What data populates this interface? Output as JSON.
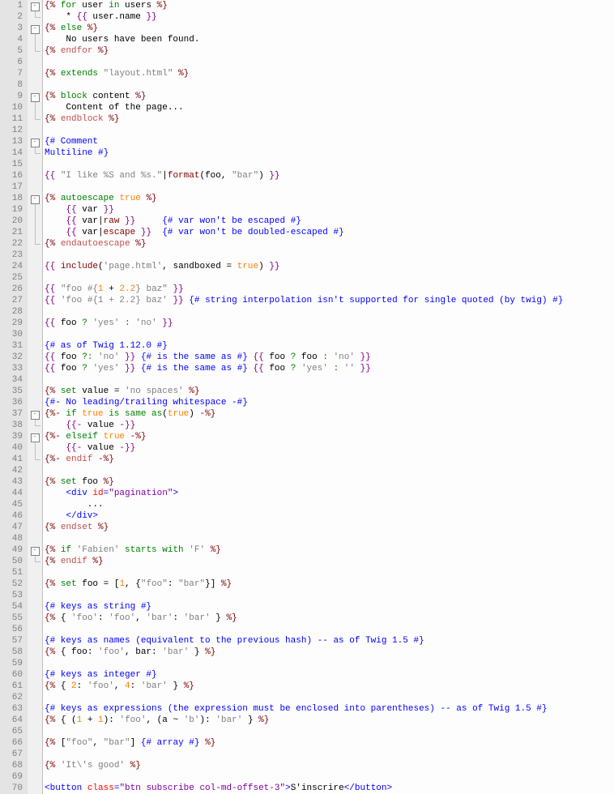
{
  "line_count": 70,
  "fold_markers": {
    "1": "open",
    "2": "line-end",
    "3": "open",
    "4": "line",
    "5": "end",
    "9": "open",
    "10": "line",
    "11": "end",
    "13": "open",
    "14": "end",
    "18": "open",
    "19": "line",
    "20": "line",
    "21": "line",
    "22": "end",
    "37": "open",
    "38": "end",
    "39": "open",
    "40": "line",
    "41": "end",
    "49": "open",
    "50": "end"
  },
  "lines": [
    {
      "n": 1,
      "segs": [
        [
          "tag",
          "{% "
        ],
        [
          "kw",
          "for"
        ],
        [
          "name",
          " user "
        ],
        [
          "kw",
          "in"
        ],
        [
          "name",
          " users "
        ],
        [
          "tag",
          "%}"
        ]
      ]
    },
    {
      "n": 2,
      "segs": [
        [
          "name",
          "    * "
        ],
        [
          "brace",
          "{{ "
        ],
        [
          "name",
          "user.name"
        ],
        [
          "brace",
          " }}"
        ]
      ]
    },
    {
      "n": 3,
      "segs": [
        [
          "tag",
          "{% "
        ],
        [
          "kw",
          "else"
        ],
        [
          "tag",
          " %}"
        ]
      ]
    },
    {
      "n": 4,
      "segs": [
        [
          "name",
          "    No users have been found."
        ]
      ]
    },
    {
      "n": 5,
      "segs": [
        [
          "tag",
          "{% "
        ],
        [
          "tgt",
          "endfor"
        ],
        [
          "tag",
          " %}"
        ]
      ]
    },
    {
      "n": 6,
      "segs": []
    },
    {
      "n": 7,
      "segs": [
        [
          "tag",
          "{% "
        ],
        [
          "kw",
          "extends"
        ],
        [
          "name",
          " "
        ],
        [
          "str",
          "\"layout.html\""
        ],
        [
          "tag",
          " %}"
        ]
      ]
    },
    {
      "n": 8,
      "segs": []
    },
    {
      "n": 9,
      "segs": [
        [
          "tag",
          "{% "
        ],
        [
          "kw",
          "block"
        ],
        [
          "name",
          " content "
        ],
        [
          "tag",
          "%}"
        ]
      ]
    },
    {
      "n": 10,
      "segs": [
        [
          "name",
          "    Content of the page..."
        ]
      ]
    },
    {
      "n": 11,
      "segs": [
        [
          "tag",
          "{% "
        ],
        [
          "tgt",
          "endblock"
        ],
        [
          "tag",
          " %}"
        ]
      ]
    },
    {
      "n": 12,
      "segs": []
    },
    {
      "n": 13,
      "segs": [
        [
          "cmt",
          "{# Comment"
        ]
      ]
    },
    {
      "n": 14,
      "segs": [
        [
          "cmt",
          "Multiline #}"
        ]
      ]
    },
    {
      "n": 15,
      "segs": []
    },
    {
      "n": 16,
      "segs": [
        [
          "brace",
          "{{ "
        ],
        [
          "str",
          "\"I like %S and %s.\""
        ],
        [
          "name",
          "|"
        ],
        [
          "func",
          "format"
        ],
        [
          "name",
          "("
        ],
        [
          "name",
          "foo"
        ],
        [
          "name",
          ", "
        ],
        [
          "str",
          "\"bar\""
        ],
        [
          "name",
          ") "
        ],
        [
          "brace",
          "}}"
        ]
      ]
    },
    {
      "n": 17,
      "segs": []
    },
    {
      "n": 18,
      "segs": [
        [
          "tag",
          "{% "
        ],
        [
          "kw",
          "autoescape"
        ],
        [
          "name",
          " "
        ],
        [
          "orange",
          "true"
        ],
        [
          "tag",
          " %}"
        ]
      ]
    },
    {
      "n": 19,
      "segs": [
        [
          "name",
          "    "
        ],
        [
          "brace",
          "{{ "
        ],
        [
          "name",
          "var"
        ],
        [
          "brace",
          " }}"
        ]
      ]
    },
    {
      "n": 20,
      "segs": [
        [
          "name",
          "    "
        ],
        [
          "brace",
          "{{ "
        ],
        [
          "name",
          "var"
        ],
        [
          "name",
          "|"
        ],
        [
          "func",
          "raw"
        ],
        [
          "brace",
          " }}"
        ],
        [
          "name",
          "     "
        ],
        [
          "cmt",
          "{# var won't be escaped #}"
        ]
      ]
    },
    {
      "n": 21,
      "segs": [
        [
          "name",
          "    "
        ],
        [
          "brace",
          "{{ "
        ],
        [
          "name",
          "var"
        ],
        [
          "name",
          "|"
        ],
        [
          "func",
          "escape"
        ],
        [
          "brace",
          " }}"
        ],
        [
          "name",
          "  "
        ],
        [
          "cmt",
          "{# var won't be doubled-escaped #}"
        ]
      ]
    },
    {
      "n": 22,
      "segs": [
        [
          "tag",
          "{% "
        ],
        [
          "tgt",
          "endautoescape"
        ],
        [
          "tag",
          " %}"
        ]
      ]
    },
    {
      "n": 23,
      "segs": []
    },
    {
      "n": 24,
      "segs": [
        [
          "brace",
          "{{ "
        ],
        [
          "func",
          "include"
        ],
        [
          "name",
          "("
        ],
        [
          "str",
          "'page.html'"
        ],
        [
          "name",
          ", "
        ],
        [
          "name",
          "sandboxed"
        ],
        [
          "name",
          " = "
        ],
        [
          "orange",
          "true"
        ],
        [
          "name",
          ") "
        ],
        [
          "brace",
          "}}"
        ]
      ]
    },
    {
      "n": 25,
      "segs": []
    },
    {
      "n": 26,
      "segs": [
        [
          "brace",
          "{{ "
        ],
        [
          "str",
          "\"foo #{"
        ],
        [
          "orange",
          "1"
        ],
        [
          "name",
          " + "
        ],
        [
          "orange",
          "2.2"
        ],
        [
          "str",
          "} baz\""
        ],
        [
          "brace",
          " }}"
        ]
      ]
    },
    {
      "n": 27,
      "segs": [
        [
          "brace",
          "{{ "
        ],
        [
          "str",
          "'foo #{1 + 2.2} baz'"
        ],
        [
          "brace",
          " }}"
        ],
        [
          "name",
          " "
        ],
        [
          "cmt",
          "{# string interpolation isn't supported for single quoted (by twig) #}"
        ]
      ]
    },
    {
      "n": 28,
      "segs": []
    },
    {
      "n": 29,
      "segs": [
        [
          "brace",
          "{{ "
        ],
        [
          "name",
          "foo "
        ],
        [
          "kw",
          "?"
        ],
        [
          "name",
          " "
        ],
        [
          "str",
          "'yes'"
        ],
        [
          "name",
          " "
        ],
        [
          "kw",
          ":"
        ],
        [
          "name",
          " "
        ],
        [
          "str",
          "'no'"
        ],
        [
          "brace",
          " }}"
        ]
      ]
    },
    {
      "n": 30,
      "segs": []
    },
    {
      "n": 31,
      "segs": [
        [
          "cmt",
          "{# as of Twig 1.12.0 #}"
        ]
      ]
    },
    {
      "n": 32,
      "segs": [
        [
          "brace",
          "{{ "
        ],
        [
          "name",
          "foo "
        ],
        [
          "kw",
          "?:"
        ],
        [
          "name",
          " "
        ],
        [
          "str",
          "'no'"
        ],
        [
          "brace",
          " }}"
        ],
        [
          "name",
          " "
        ],
        [
          "cmt",
          "{# is the same as #}"
        ],
        [
          "name",
          " "
        ],
        [
          "brace",
          "{{ "
        ],
        [
          "name",
          "foo "
        ],
        [
          "kw",
          "?"
        ],
        [
          "name",
          " foo "
        ],
        [
          "kw",
          ":"
        ],
        [
          "name",
          " "
        ],
        [
          "str",
          "'no'"
        ],
        [
          "brace",
          " }}"
        ]
      ]
    },
    {
      "n": 33,
      "segs": [
        [
          "brace",
          "{{ "
        ],
        [
          "name",
          "foo "
        ],
        [
          "kw",
          "?"
        ],
        [
          "name",
          " "
        ],
        [
          "str",
          "'yes'"
        ],
        [
          "brace",
          " }}"
        ],
        [
          "name",
          " "
        ],
        [
          "cmt",
          "{# is the same as #}"
        ],
        [
          "name",
          " "
        ],
        [
          "brace",
          "{{ "
        ],
        [
          "name",
          "foo "
        ],
        [
          "kw",
          "?"
        ],
        [
          "name",
          " "
        ],
        [
          "str",
          "'yes'"
        ],
        [
          "name",
          " "
        ],
        [
          "kw",
          ":"
        ],
        [
          "name",
          " "
        ],
        [
          "str",
          "''"
        ],
        [
          "brace",
          " }}"
        ]
      ]
    },
    {
      "n": 34,
      "segs": []
    },
    {
      "n": 35,
      "segs": [
        [
          "tag",
          "{% "
        ],
        [
          "kw",
          "set"
        ],
        [
          "name",
          " value = "
        ],
        [
          "str",
          "'no spaces'"
        ],
        [
          "tag",
          " %}"
        ]
      ]
    },
    {
      "n": 36,
      "segs": [
        [
          "cmt",
          "{#- No leading/trailing whitespace -#}"
        ]
      ]
    },
    {
      "n": 37,
      "segs": [
        [
          "tag",
          "{%- "
        ],
        [
          "kw",
          "if"
        ],
        [
          "name",
          " "
        ],
        [
          "orange",
          "true"
        ],
        [
          "name",
          " "
        ],
        [
          "kw",
          "is"
        ],
        [
          "name",
          " "
        ],
        [
          "kw",
          "same as"
        ],
        [
          "name",
          "("
        ],
        [
          "orange",
          "true"
        ],
        [
          "name",
          ") "
        ],
        [
          "tag",
          "-%}"
        ]
      ]
    },
    {
      "n": 38,
      "segs": [
        [
          "name",
          "    "
        ],
        [
          "brace",
          "{{- "
        ],
        [
          "name",
          "value"
        ],
        [
          "brace",
          " -}}"
        ]
      ]
    },
    {
      "n": 39,
      "segs": [
        [
          "tag",
          "{%- "
        ],
        [
          "kw",
          "elseif"
        ],
        [
          "name",
          " "
        ],
        [
          "orange",
          "true"
        ],
        [
          "tag",
          " -%}"
        ]
      ]
    },
    {
      "n": 40,
      "segs": [
        [
          "name",
          "    "
        ],
        [
          "brace",
          "{{- "
        ],
        [
          "name",
          "value"
        ],
        [
          "brace",
          " -}}"
        ]
      ]
    },
    {
      "n": 41,
      "segs": [
        [
          "tag",
          "{%- "
        ],
        [
          "tgt",
          "endif"
        ],
        [
          "tag",
          " -%}"
        ]
      ]
    },
    {
      "n": 42,
      "segs": []
    },
    {
      "n": 43,
      "segs": [
        [
          "tag",
          "{% "
        ],
        [
          "kw",
          "set"
        ],
        [
          "name",
          " foo "
        ],
        [
          "tag",
          "%}"
        ]
      ]
    },
    {
      "n": 44,
      "segs": [
        [
          "name",
          "    "
        ],
        [
          "html-tag",
          "<div "
        ],
        [
          "html-attr",
          "id"
        ],
        [
          "html-tag",
          "="
        ],
        [
          "html-str",
          "\"pagination\""
        ],
        [
          "html-tag",
          ">"
        ]
      ]
    },
    {
      "n": 45,
      "segs": [
        [
          "name",
          "        ..."
        ]
      ]
    },
    {
      "n": 46,
      "segs": [
        [
          "name",
          "    "
        ],
        [
          "html-tag",
          "</div>"
        ]
      ]
    },
    {
      "n": 47,
      "segs": [
        [
          "tag",
          "{% "
        ],
        [
          "tgt",
          "endset"
        ],
        [
          "tag",
          " %}"
        ]
      ]
    },
    {
      "n": 48,
      "segs": []
    },
    {
      "n": 49,
      "segs": [
        [
          "tag",
          "{% "
        ],
        [
          "kw",
          "if"
        ],
        [
          "name",
          " "
        ],
        [
          "str",
          "'Fabien'"
        ],
        [
          "name",
          " "
        ],
        [
          "kw",
          "starts with"
        ],
        [
          "name",
          " "
        ],
        [
          "str",
          "'F'"
        ],
        [
          "tag",
          " %}"
        ]
      ]
    },
    {
      "n": 50,
      "segs": [
        [
          "tag",
          "{% "
        ],
        [
          "tgt",
          "endif"
        ],
        [
          "tag",
          " %}"
        ]
      ]
    },
    {
      "n": 51,
      "segs": []
    },
    {
      "n": 52,
      "segs": [
        [
          "tag",
          "{% "
        ],
        [
          "kw",
          "set"
        ],
        [
          "name",
          " foo = ["
        ],
        [
          "orange",
          "1"
        ],
        [
          "name",
          ", {"
        ],
        [
          "str",
          "\"foo\""
        ],
        [
          "name",
          ": "
        ],
        [
          "str",
          "\"bar\""
        ],
        [
          "name",
          "}] "
        ],
        [
          "tag",
          "%}"
        ]
      ]
    },
    {
      "n": 53,
      "segs": []
    },
    {
      "n": 54,
      "segs": [
        [
          "cmt",
          "{# keys as string #}"
        ]
      ]
    },
    {
      "n": 55,
      "segs": [
        [
          "tag",
          "{% "
        ],
        [
          "name",
          "{ "
        ],
        [
          "str",
          "'foo'"
        ],
        [
          "name",
          ": "
        ],
        [
          "str",
          "'foo'"
        ],
        [
          "name",
          ", "
        ],
        [
          "str",
          "'bar'"
        ],
        [
          "name",
          ": "
        ],
        [
          "str",
          "'bar'"
        ],
        [
          "name",
          " } "
        ],
        [
          "tag",
          "%}"
        ]
      ]
    },
    {
      "n": 56,
      "segs": []
    },
    {
      "n": 57,
      "segs": [
        [
          "cmt",
          "{# keys as names (equivalent to the previous hash) -- as of Twig 1.5 #}"
        ]
      ]
    },
    {
      "n": 58,
      "segs": [
        [
          "tag",
          "{% "
        ],
        [
          "name",
          "{ foo: "
        ],
        [
          "str",
          "'foo'"
        ],
        [
          "name",
          ", bar: "
        ],
        [
          "str",
          "'bar'"
        ],
        [
          "name",
          " } "
        ],
        [
          "tag",
          "%}"
        ]
      ]
    },
    {
      "n": 59,
      "segs": []
    },
    {
      "n": 60,
      "segs": [
        [
          "cmt",
          "{# keys as integer #}"
        ]
      ]
    },
    {
      "n": 61,
      "segs": [
        [
          "tag",
          "{% "
        ],
        [
          "name",
          "{ "
        ],
        [
          "orange",
          "2"
        ],
        [
          "name",
          ": "
        ],
        [
          "str",
          "'foo'"
        ],
        [
          "name",
          ", "
        ],
        [
          "orange",
          "4"
        ],
        [
          "name",
          ": "
        ],
        [
          "str",
          "'bar'"
        ],
        [
          "name",
          " } "
        ],
        [
          "tag",
          "%}"
        ]
      ]
    },
    {
      "n": 62,
      "segs": []
    },
    {
      "n": 63,
      "segs": [
        [
          "cmt",
          "{# keys as expressions (the expression must be enclosed into parentheses) -- as of Twig 1.5 #}"
        ]
      ]
    },
    {
      "n": 64,
      "segs": [
        [
          "tag",
          "{% "
        ],
        [
          "name",
          "{ ("
        ],
        [
          "orange",
          "1"
        ],
        [
          "name",
          " + "
        ],
        [
          "orange",
          "1"
        ],
        [
          "name",
          "): "
        ],
        [
          "str",
          "'foo'"
        ],
        [
          "name",
          ", (a ~ "
        ],
        [
          "str",
          "'b'"
        ],
        [
          "name",
          "): "
        ],
        [
          "str",
          "'bar'"
        ],
        [
          "name",
          " } "
        ],
        [
          "tag",
          "%}"
        ]
      ]
    },
    {
      "n": 65,
      "segs": []
    },
    {
      "n": 66,
      "segs": [
        [
          "tag",
          "{% "
        ],
        [
          "name",
          "["
        ],
        [
          "str",
          "\"foo\""
        ],
        [
          "name",
          ", "
        ],
        [
          "str",
          "\"bar\""
        ],
        [
          "name",
          "] "
        ],
        [
          "cmt",
          "{# array #}"
        ],
        [
          "tag",
          " %}"
        ]
      ]
    },
    {
      "n": 67,
      "segs": []
    },
    {
      "n": 68,
      "segs": [
        [
          "tag",
          "{% "
        ],
        [
          "str",
          "'It\\'s good'"
        ],
        [
          "tag",
          " %}"
        ]
      ]
    },
    {
      "n": 69,
      "segs": []
    },
    {
      "n": 70,
      "segs": [
        [
          "html-tag",
          "<button "
        ],
        [
          "html-attr",
          "class"
        ],
        [
          "html-tag",
          "="
        ],
        [
          "html-str",
          "\"btn subscribe col-md-offset-3\""
        ],
        [
          "html-tag",
          ">"
        ],
        [
          "name",
          "S'inscrire"
        ],
        [
          "html-tag",
          "</button>"
        ]
      ]
    }
  ]
}
